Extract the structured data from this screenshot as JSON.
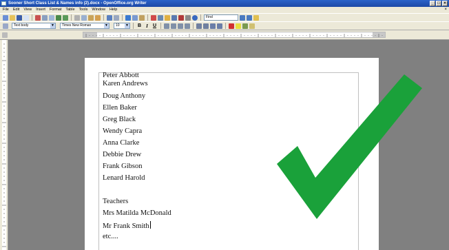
{
  "window": {
    "title": "Sooner Short Class List & Names info (2).docx - OpenOffice.org Writer"
  },
  "menu": {
    "items": [
      "File",
      "Edit",
      "View",
      "Insert",
      "Format",
      "Table",
      "Tools",
      "Window",
      "Help"
    ]
  },
  "toolbar": {
    "find_value": "Find",
    "paragraph_style": "Text body",
    "font_name": "Times New Roman",
    "font_size": "10",
    "bold": "B",
    "italic": "I",
    "underline": "U"
  },
  "document": {
    "lines": [
      "Peter Abbott",
      "Karen Andrews",
      "Doug Anthony",
      "Ellen Baker",
      "Greg Black",
      "Wendy Capra",
      "Anna Clarke",
      "Debbie Drew",
      "Frank Gibson",
      "Lenard Harold",
      "",
      "Teachers",
      "Mrs Matilda McDonald",
      "Mr Frank Smith",
      "etc...."
    ]
  },
  "colors": {
    "checkmark": "#1aa13a",
    "title_bar": "#2b63c9"
  }
}
